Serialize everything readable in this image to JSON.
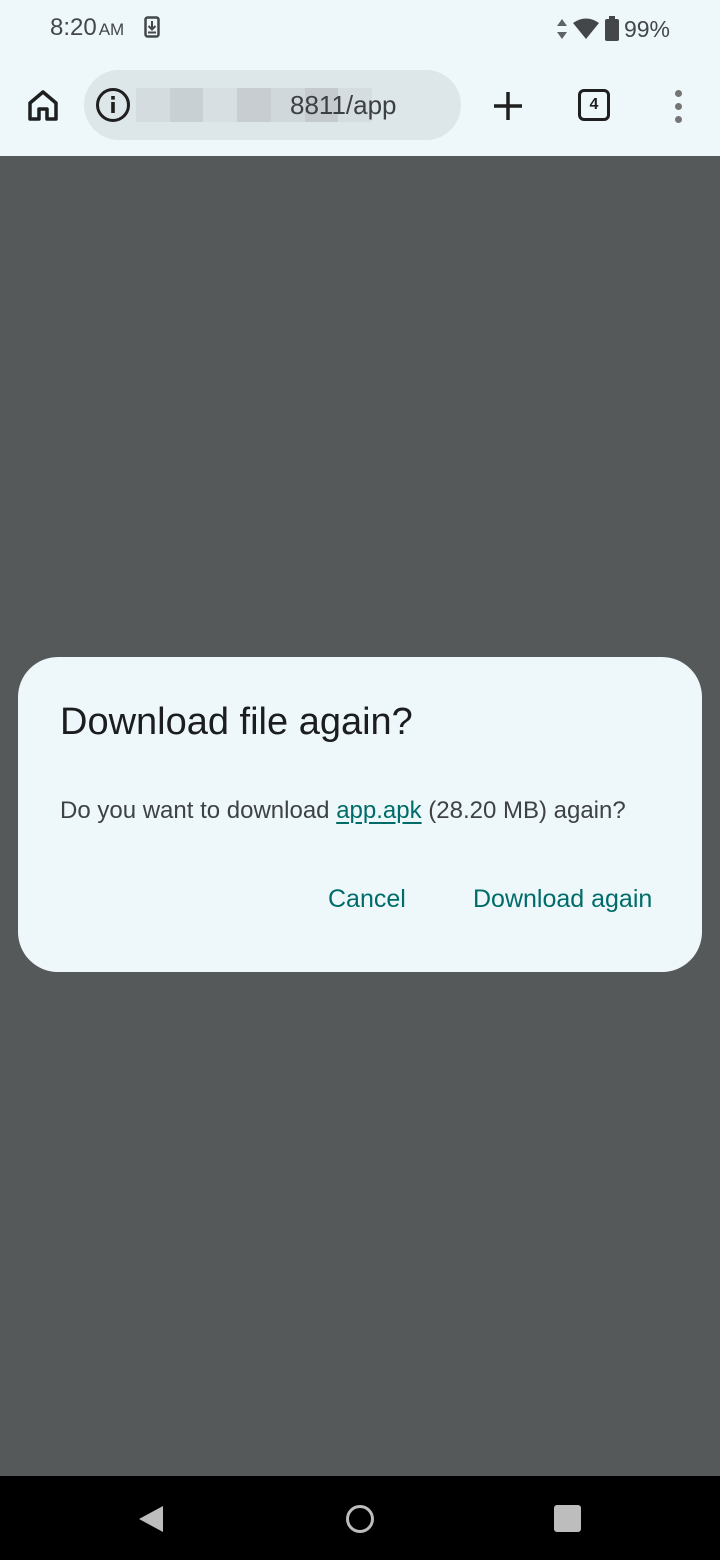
{
  "status_bar": {
    "time": "8:20",
    "ampm": "AM",
    "battery": "99%",
    "icons": [
      "download-indicator-icon",
      "data-arrows-icon",
      "wifi-icon",
      "battery-icon"
    ]
  },
  "browser": {
    "url_suffix": "8811/app",
    "tab_count": "4",
    "icons": [
      "home-icon",
      "site-info-icon",
      "new-tab-plus-icon",
      "tab-switcher-icon",
      "overflow-menu-icon"
    ]
  },
  "dialog": {
    "title": "Download file again?",
    "body_prefix": "Do you want to download ",
    "file_name": "app.apk",
    "body_suffix": " (28.20 MB) again?",
    "cancel_label": "Cancel",
    "confirm_label": "Download again",
    "accent_color": "#006c69"
  },
  "nav_bar": {
    "icons": [
      "back-icon",
      "home-circle-icon",
      "recents-icon"
    ]
  }
}
